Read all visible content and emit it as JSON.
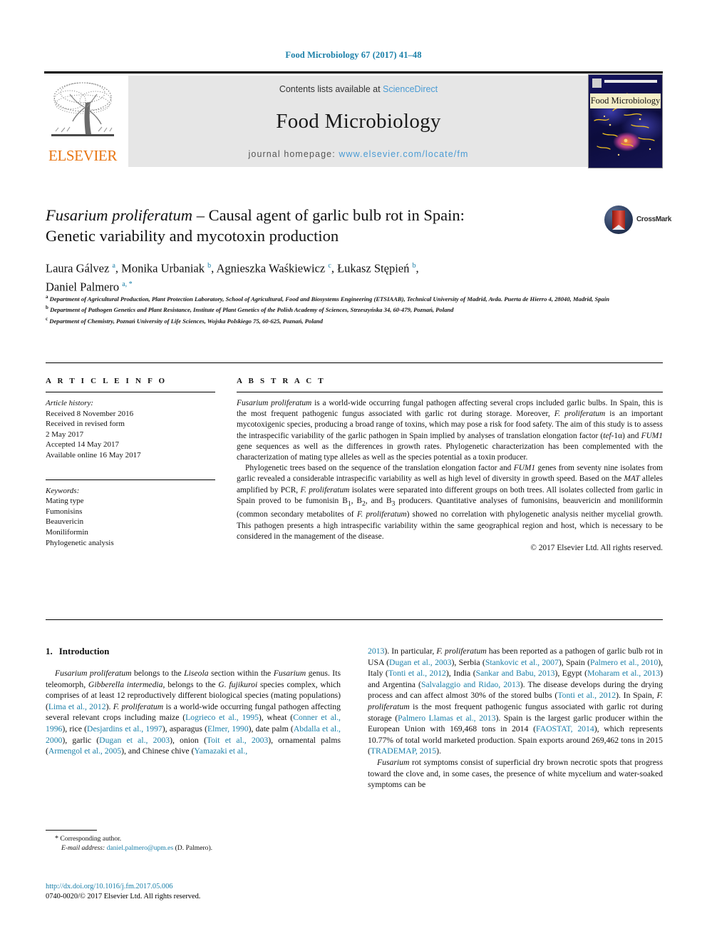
{
  "running_head": "Food Microbiology 67 (2017) 41–48",
  "masthead": {
    "contents_prefix": "Contents lists available at ",
    "sciencedirect": "ScienceDirect",
    "journal_title": "Food Microbiology",
    "homepage_prefix": "journal homepage: ",
    "homepage_url": "www.elsevier.com/locate/fm",
    "publisher": "ELSEVIER",
    "cover_band_title": "Food Microbiology",
    "accent_link_color": "#4a9bd4",
    "running_head_color": "#1a7fa8",
    "elsevier_orange": "#e87511"
  },
  "crossmark": {
    "label": "CrossMark"
  },
  "title": {
    "line1_italic": "Fusarium proliferatum",
    "line1_rest": " – Causal agent of garlic bulb rot in Spain:",
    "line2": "Genetic variability and mycotoxin production"
  },
  "authors": {
    "line1": "Laura Gálvez a, Monika Urbaniak b, Agnieszka Waśkiewicz c, Łukasz Stępień b,",
    "line2": "Daniel Palmero a, *",
    "list": [
      {
        "name": "Laura Gálvez",
        "marks": "a"
      },
      {
        "name": "Monika Urbaniak",
        "marks": "b"
      },
      {
        "name": "Agnieszka Waśkiewicz",
        "marks": "c"
      },
      {
        "name": "Łukasz Stępień",
        "marks": "b"
      },
      {
        "name": "Daniel Palmero",
        "marks": "a, *"
      }
    ]
  },
  "affiliations": [
    {
      "mark": "a",
      "text": "Department of Agricultural Production, Plant Protection Laboratory, School of Agricultural, Food and Biosystems Engineering (ETSIAAB), Technical University of Madrid, Avda. Puerta de Hierro 4, 28040, Madrid, Spain"
    },
    {
      "mark": "b",
      "text": "Department of Pathogen Genetics and Plant Resistance, Institute of Plant Genetics of the Polish Academy of Sciences, Strzeszyńska 34, 60-479, Poznań, Poland"
    },
    {
      "mark": "c",
      "text": "Department of Chemistry, Poznań University of Life Sciences, Wojska Polskiego 75, 60-625, Poznań, Poland"
    }
  ],
  "article_info": {
    "heading": "A R T I C L E   I N F O",
    "history_label": "Article history:",
    "history": [
      "Received 8 November 2016",
      "Received in revised form",
      "2 May 2017",
      "Accepted 14 May 2017",
      "Available online 16 May 2017"
    ],
    "keywords_label": "Keywords:",
    "keywords": [
      "Mating type",
      "Fumonisins",
      "Beauvericin",
      "Moniliformin",
      "Phylogenetic analysis"
    ]
  },
  "abstract": {
    "heading": "A B S T R A C T",
    "paragraph1_pre": "",
    "paragraph1": "Fusarium proliferatum is a world-wide occurring fungal pathogen affecting several crops included garlic bulbs. In Spain, this is the most frequent pathogenic fungus associated with garlic rot during storage. Moreover, F. proliferatum is an important mycotoxigenic species, producing a broad range of toxins, which may pose a risk for food safety. The aim of this study is to assess the intraspecific variability of the garlic pathogen in Spain implied by analyses of translation elongation factor (tef-1α) and FUM1 gene sequences as well as the differences in growth rates. Phylogenetic characterization has been complemented with the characterization of mating type alleles as well as the species potential as a toxin producer.",
    "paragraph2": "Phylogenetic trees based on the sequence of the translation elongation factor and FUM1 genes from seventy nine isolates from garlic revealed a considerable intraspecific variability as well as high level of diversity in growth speed. Based on the MAT alleles amplified by PCR, F. proliferatum isolates were separated into different groups on both trees. All isolates collected from garlic in Spain proved to be fumonisin B1, B2, and B3 producers. Quantitative analyses of fumonisins, beauvericin and moniliformin (common secondary metabolites of F. proliferatum) showed no correlation with phylogenetic analysis neither mycelial growth. This pathogen presents a high intraspecific variability within the same geographical region and host, which is necessary to be considered in the management of the disease.",
    "copyright": "© 2017 Elsevier Ltd. All rights reserved."
  },
  "introduction": {
    "number": "1.",
    "heading": "Introduction",
    "left_paragraph1": "Fusarium proliferatum belongs to the Liseola section within the Fusarium genus. Its teleomorph, Gibberella intermedia, belongs to the G. fujikuroi species complex, which comprises of at least 12 reproductively different biological species (mating populations) (Lima et al., 2012). F. proliferatum is a world-wide occurring fungal pathogen affecting several relevant crops including maize (Logrieco et al., 1995), wheat (Conner et al., 1996), rice (Desjardins et al., 1997), asparagus (Elmer, 1990), date palm (Abdalla et al., 2000), garlic (Dugan et al., 2003), onion (Toit et al., 2003), ornamental palms (Armengol et al., 2005), and Chinese chive (Yamazaki et al.,",
    "right_paragraph1": "2013). In particular, F. proliferatum has been reported as a pathogen of garlic bulb rot in USA (Dugan et al., 2003), Serbia (Stankovic et al., 2007), Spain (Palmero et al., 2010), Italy (Tonti et al., 2012), India (Sankar and Babu, 2013), Egypt (Moharam et al., 2013) and Argentina (Salvalaggio and Ridao, 2013). The disease develops during the drying process and can affect almost 30% of the stored bulbs (Tonti et al., 2012). In Spain, F. proliferatum is the most frequent pathogenic fungus associated with garlic rot during storage (Palmero Llamas et al., 2013). Spain is the largest garlic producer within the European Union with 169,468 tons in 2014 (FAOSTAT, 2014), which represents 10.77% of total world marketed production. Spain exports around 269,462 tons in 2015 (TRADEMAP, 2015).",
    "right_paragraph2": "Fusarium rot symptoms consist of superficial dry brown necrotic spots that progress toward the clove and, in some cases, the presence of white mycelium and water-soaked symptoms can be"
  },
  "footnote": {
    "star": "*",
    "corresponding": "Corresponding author.",
    "email_label": "E-mail address:",
    "email": "daniel.palmero@upm.es",
    "email_attrib": "(D. Palmero)."
  },
  "imprint": {
    "doi": "http://dx.doi.org/10.1016/j.fm.2017.05.006",
    "issn_line": "0740-0020/© 2017 Elsevier Ltd. All rights reserved."
  }
}
